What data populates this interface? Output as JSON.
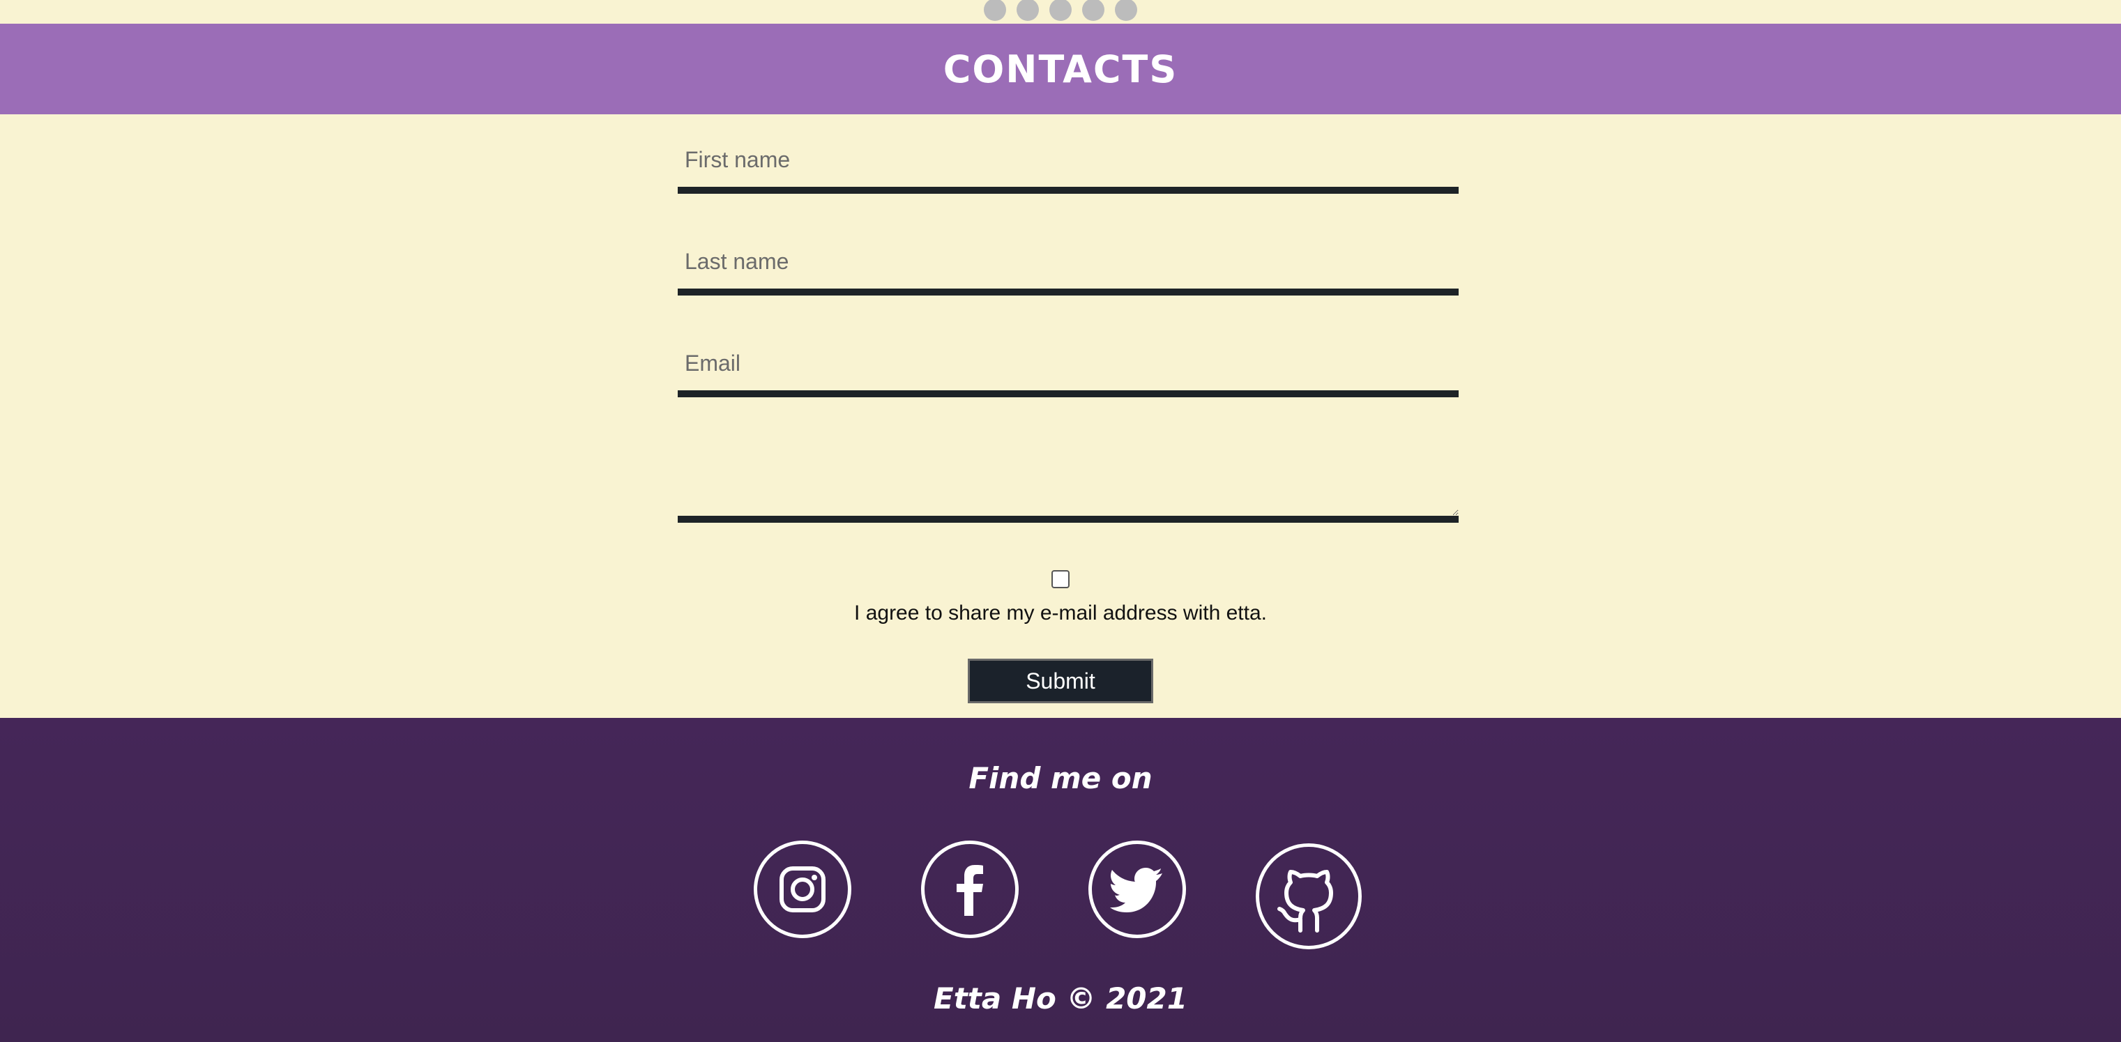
{
  "header": {
    "title": "CONTACTS"
  },
  "slider_dots": {
    "count": 5,
    "color": "#bcbcbc"
  },
  "form": {
    "first_name_placeholder": "First name",
    "last_name_placeholder": "Last name",
    "email_placeholder": "Email",
    "message_value": "",
    "consent_label": "I agree to share my e-mail address with etta.",
    "consent_checked": false,
    "submit_label": "Submit"
  },
  "footer": {
    "find_title": "Find me on",
    "socials": [
      {
        "name": "instagram-icon"
      },
      {
        "name": "facebook-icon"
      },
      {
        "name": "twitter-icon"
      },
      {
        "name": "github-icon"
      }
    ],
    "copyright": "Etta Ho © 2021"
  },
  "colors": {
    "background": "#f9f3d2",
    "header": "#9b6db7",
    "footer": "#452658",
    "input_border": "#1e2327",
    "submit_bg": "#1b222b"
  }
}
